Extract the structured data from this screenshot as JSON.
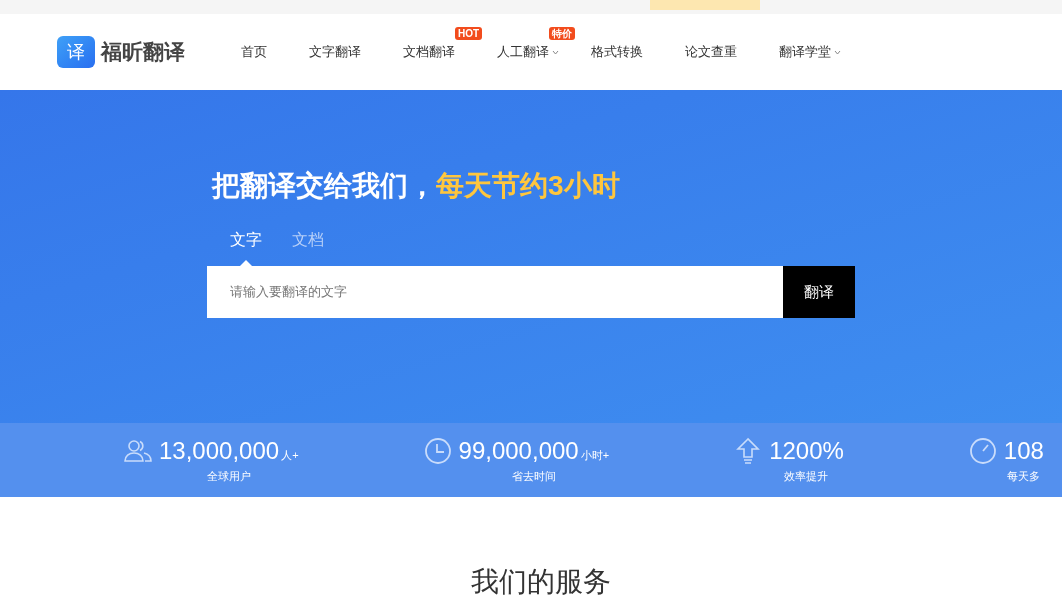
{
  "brand": {
    "name": "福昕翻译",
    "logo_glyph": "译"
  },
  "nav": [
    {
      "label": "首页",
      "dropdown": false
    },
    {
      "label": "文字翻译",
      "dropdown": false
    },
    {
      "label": "文档翻译",
      "badge": "HOT",
      "dropdown": false
    },
    {
      "label": "人工翻译",
      "badge": "特价",
      "dropdown": true
    },
    {
      "label": "格式转换",
      "dropdown": false
    },
    {
      "label": "论文查重",
      "dropdown": false
    },
    {
      "label": "翻译学堂",
      "dropdown": true
    }
  ],
  "hero": {
    "headline": "把翻译交给我们，",
    "highlight": "每天节约3小时",
    "tabs": [
      {
        "label": "文字",
        "selected": true
      },
      {
        "label": "文档",
        "selected": false
      }
    ],
    "input": {
      "placeholder": "请输入要翻译的文字"
    },
    "button": "翻译"
  },
  "stats": [
    {
      "kind": "users",
      "value": "13,000,000",
      "unit": "人+",
      "label": "全球用户"
    },
    {
      "kind": "clock",
      "value": "99,000,000",
      "unit": "小时+",
      "label": "省去时间"
    },
    {
      "kind": "arrow",
      "value": "1200%",
      "label": "效率提升"
    },
    {
      "kind": "gauge",
      "value": "108",
      "label": "每天多"
    }
  ],
  "section_title": "我们的服务"
}
